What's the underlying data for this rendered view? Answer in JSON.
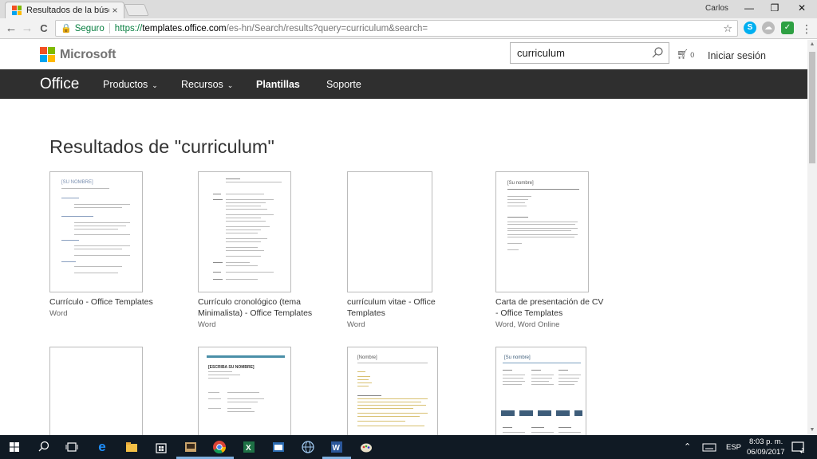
{
  "browser": {
    "tab_title": "Resultados de la búsqued",
    "tab_close": "×",
    "user_name": "Carlos",
    "minimize": "—",
    "restore": "❐",
    "close": "✕",
    "secure_label": "Seguro",
    "url_scheme": "https://",
    "url_host": "templates.office.com",
    "url_path": "/es-hn/Search/results?query=curriculum&search=",
    "back": "←",
    "forward": "→",
    "reload": "C",
    "menu": "⋮",
    "star": "☆"
  },
  "ms_header": {
    "logo_text": "Microsoft",
    "search_value": "curriculum",
    "cart_count": "0",
    "signin_label": "Iniciar sesión"
  },
  "office_nav": {
    "brand": "Office",
    "items": [
      {
        "label": "Productos",
        "chevron": "⌄"
      },
      {
        "label": "Recursos",
        "chevron": "⌄"
      },
      {
        "label": "Plantillas"
      },
      {
        "label": "Soporte"
      }
    ]
  },
  "results": {
    "heading": "Resultados de \"curriculum\"",
    "cards": [
      {
        "title": "Currículo - Office Templates",
        "subtitle": "Word"
      },
      {
        "title": "Currículo cronológico (tema Minimalista) - Office Templates",
        "subtitle": "Word"
      },
      {
        "title": "currículum vitae - Office Templates",
        "subtitle": "Word"
      },
      {
        "title": "Carta de presentación de CV - Office Templates",
        "subtitle": "Word, Word Online"
      }
    ],
    "thumb_texts": {
      "card1": "[SU NOMBRE]",
      "card4": "[Su nombre]",
      "card6": "[ESCRIBA SU NOMBRE]",
      "card7": "[Nombre]",
      "card8": "[Su nombre]"
    }
  },
  "taskbar": {
    "language": "ESP",
    "time": "8:03 p. m.",
    "date": "06/09/2017",
    "notification_count": "1"
  },
  "colors": {
    "office_nav_bg": "#2f2f2f",
    "taskbar_bg": "#101a24",
    "secure_green": "#0b8043",
    "ms_red": "#f25022",
    "ms_green": "#7fba00",
    "ms_blue": "#00a4ef",
    "ms_yellow": "#ffb900"
  }
}
